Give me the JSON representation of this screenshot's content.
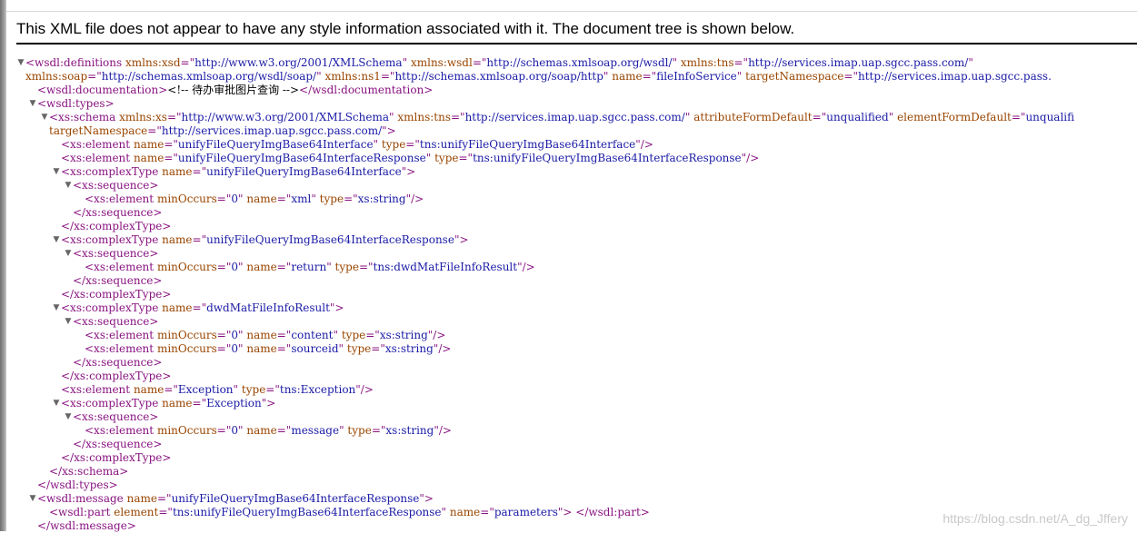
{
  "header": {
    "message": "This XML file does not appear to have any style information associated with it. The document tree is shown below."
  },
  "toggle_glyph": "▼",
  "tree": [
    {
      "segs": [
        [
          "tag",
          "<wsdl:definitions"
        ],
        [
          "txt",
          " "
        ],
        [
          "an",
          "xmlns:xsd"
        ],
        [
          "tag",
          "=\""
        ],
        [
          "av",
          "http://www.w3.org/2001/XMLSchema"
        ],
        [
          "tag",
          "\""
        ],
        [
          "txt",
          " "
        ],
        [
          "an",
          "xmlns:wsdl"
        ],
        [
          "tag",
          "=\""
        ],
        [
          "av",
          "http://schemas.xmlsoap.org/wsdl/"
        ],
        [
          "tag",
          "\""
        ],
        [
          "txt",
          " "
        ],
        [
          "an",
          "xmlns:tns"
        ],
        [
          "tag",
          "=\""
        ],
        [
          "av",
          "http://services.imap.uap.sgcc.pass.com/"
        ],
        [
          "tag",
          "\""
        ]
      ],
      "toggle": true
    },
    {
      "segs": [
        [
          "an",
          "xmlns:soap"
        ],
        [
          "tag",
          "=\""
        ],
        [
          "av",
          "http://schemas.xmlsoap.org/wsdl/soap/"
        ],
        [
          "tag",
          "\""
        ],
        [
          "txt",
          " "
        ],
        [
          "an",
          "xmlns:ns1"
        ],
        [
          "tag",
          "=\""
        ],
        [
          "av",
          "http://schemas.xmlsoap.org/soap/http"
        ],
        [
          "tag",
          "\""
        ],
        [
          "txt",
          " "
        ],
        [
          "an",
          "name"
        ],
        [
          "tag",
          "=\""
        ],
        [
          "av",
          "fileInfoService"
        ],
        [
          "tag",
          "\""
        ],
        [
          "txt",
          " "
        ],
        [
          "an",
          "targetNamespace"
        ],
        [
          "tag",
          "=\""
        ],
        [
          "av",
          "http://services.imap.uap.sgcc.pass."
        ]
      ]
    },
    {
      "segs": [
        [
          "tag",
          "<wsdl:documentation>"
        ],
        [
          "txt",
          "<!-- 待办审批图片查询 -->"
        ],
        [
          "tag",
          "</wsdl:documentation>"
        ]
      ]
    },
    {
      "segs": [
        [
          "tag",
          "<wsdl:types>"
        ]
      ],
      "toggle": true
    },
    {
      "segs": [
        [
          "tag",
          "<xs:schema"
        ],
        [
          "txt",
          " "
        ],
        [
          "an",
          "xmlns:xs"
        ],
        [
          "tag",
          "=\""
        ],
        [
          "av",
          "http://www.w3.org/2001/XMLSchema"
        ],
        [
          "tag",
          "\""
        ],
        [
          "txt",
          " "
        ],
        [
          "an",
          "xmlns:tns"
        ],
        [
          "tag",
          "=\""
        ],
        [
          "av",
          "http://services.imap.uap.sgcc.pass.com/"
        ],
        [
          "tag",
          "\""
        ],
        [
          "txt",
          " "
        ],
        [
          "an",
          "attributeFormDefault"
        ],
        [
          "tag",
          "=\""
        ],
        [
          "av",
          "unqualified"
        ],
        [
          "tag",
          "\""
        ],
        [
          "txt",
          " "
        ],
        [
          "an",
          "elementFormDefault"
        ],
        [
          "tag",
          "=\""
        ],
        [
          "av",
          "unqualifi"
        ]
      ],
      "toggle": true
    },
    {
      "segs": [
        [
          "an",
          "targetNamespace"
        ],
        [
          "tag",
          "=\""
        ],
        [
          "av",
          "http://services.imap.uap.sgcc.pass.com/"
        ],
        [
          "tag",
          "\">"
        ]
      ]
    },
    {
      "segs": [
        [
          "tag",
          "<xs:element"
        ],
        [
          "txt",
          " "
        ],
        [
          "an",
          "name"
        ],
        [
          "tag",
          "=\""
        ],
        [
          "av",
          "unifyFileQueryImgBase64Interface"
        ],
        [
          "tag",
          "\""
        ],
        [
          "txt",
          " "
        ],
        [
          "an",
          "type"
        ],
        [
          "tag",
          "=\""
        ],
        [
          "av",
          "tns:unifyFileQueryImgBase64Interface"
        ],
        [
          "tag",
          "\"/>"
        ]
      ]
    },
    {
      "segs": [
        [
          "tag",
          "<xs:element"
        ],
        [
          "txt",
          " "
        ],
        [
          "an",
          "name"
        ],
        [
          "tag",
          "=\""
        ],
        [
          "av",
          "unifyFileQueryImgBase64InterfaceResponse"
        ],
        [
          "tag",
          "\""
        ],
        [
          "txt",
          " "
        ],
        [
          "an",
          "type"
        ],
        [
          "tag",
          "=\""
        ],
        [
          "av",
          "tns:unifyFileQueryImgBase64InterfaceResponse"
        ],
        [
          "tag",
          "\"/>"
        ]
      ]
    },
    {
      "segs": [
        [
          "tag",
          "<xs:complexType"
        ],
        [
          "txt",
          " "
        ],
        [
          "an",
          "name"
        ],
        [
          "tag",
          "=\""
        ],
        [
          "av",
          "unifyFileQueryImgBase64Interface"
        ],
        [
          "tag",
          "\">"
        ]
      ],
      "toggle": true
    },
    {
      "segs": [
        [
          "tag",
          "<xs:sequence>"
        ]
      ],
      "toggle": true
    },
    {
      "segs": [
        [
          "tag",
          "<xs:element"
        ],
        [
          "txt",
          " "
        ],
        [
          "an",
          "minOccurs"
        ],
        [
          "tag",
          "=\""
        ],
        [
          "av",
          "0"
        ],
        [
          "tag",
          "\""
        ],
        [
          "txt",
          " "
        ],
        [
          "an",
          "name"
        ],
        [
          "tag",
          "=\""
        ],
        [
          "av",
          "xml"
        ],
        [
          "tag",
          "\""
        ],
        [
          "txt",
          " "
        ],
        [
          "an",
          "type"
        ],
        [
          "tag",
          "=\""
        ],
        [
          "av",
          "xs:string"
        ],
        [
          "tag",
          "\"/>"
        ]
      ]
    },
    {
      "segs": [
        [
          "tag",
          "</xs:sequence>"
        ]
      ]
    },
    {
      "segs": [
        [
          "tag",
          "</xs:complexType>"
        ]
      ]
    },
    {
      "segs": [
        [
          "tag",
          "<xs:complexType"
        ],
        [
          "txt",
          " "
        ],
        [
          "an",
          "name"
        ],
        [
          "tag",
          "=\""
        ],
        [
          "av",
          "unifyFileQueryImgBase64InterfaceResponse"
        ],
        [
          "tag",
          "\">"
        ]
      ],
      "toggle": true
    },
    {
      "segs": [
        [
          "tag",
          "<xs:sequence>"
        ]
      ],
      "toggle": true
    },
    {
      "segs": [
        [
          "tag",
          "<xs:element"
        ],
        [
          "txt",
          " "
        ],
        [
          "an",
          "minOccurs"
        ],
        [
          "tag",
          "=\""
        ],
        [
          "av",
          "0"
        ],
        [
          "tag",
          "\""
        ],
        [
          "txt",
          " "
        ],
        [
          "an",
          "name"
        ],
        [
          "tag",
          "=\""
        ],
        [
          "av",
          "return"
        ],
        [
          "tag",
          "\""
        ],
        [
          "txt",
          " "
        ],
        [
          "an",
          "type"
        ],
        [
          "tag",
          "=\""
        ],
        [
          "av",
          "tns:dwdMatFileInfoResult"
        ],
        [
          "tag",
          "\"/>"
        ]
      ]
    },
    {
      "segs": [
        [
          "tag",
          "</xs:sequence>"
        ]
      ]
    },
    {
      "segs": [
        [
          "tag",
          "</xs:complexType>"
        ]
      ]
    },
    {
      "segs": [
        [
          "tag",
          "<xs:complexType"
        ],
        [
          "txt",
          " "
        ],
        [
          "an",
          "name"
        ],
        [
          "tag",
          "=\""
        ],
        [
          "av",
          "dwdMatFileInfoResult"
        ],
        [
          "tag",
          "\">"
        ]
      ],
      "toggle": true
    },
    {
      "segs": [
        [
          "tag",
          "<xs:sequence>"
        ]
      ],
      "toggle": true
    },
    {
      "segs": [
        [
          "tag",
          "<xs:element"
        ],
        [
          "txt",
          " "
        ],
        [
          "an",
          "minOccurs"
        ],
        [
          "tag",
          "=\""
        ],
        [
          "av",
          "0"
        ],
        [
          "tag",
          "\""
        ],
        [
          "txt",
          " "
        ],
        [
          "an",
          "name"
        ],
        [
          "tag",
          "=\""
        ],
        [
          "av",
          "content"
        ],
        [
          "tag",
          "\""
        ],
        [
          "txt",
          " "
        ],
        [
          "an",
          "type"
        ],
        [
          "tag",
          "=\""
        ],
        [
          "av",
          "xs:string"
        ],
        [
          "tag",
          "\"/>"
        ]
      ]
    },
    {
      "segs": [
        [
          "tag",
          "<xs:element"
        ],
        [
          "txt",
          " "
        ],
        [
          "an",
          "minOccurs"
        ],
        [
          "tag",
          "=\""
        ],
        [
          "av",
          "0"
        ],
        [
          "tag",
          "\""
        ],
        [
          "txt",
          " "
        ],
        [
          "an",
          "name"
        ],
        [
          "tag",
          "=\""
        ],
        [
          "av",
          "sourceid"
        ],
        [
          "tag",
          "\""
        ],
        [
          "txt",
          " "
        ],
        [
          "an",
          "type"
        ],
        [
          "tag",
          "=\""
        ],
        [
          "av",
          "xs:string"
        ],
        [
          "tag",
          "\"/>"
        ]
      ]
    },
    {
      "segs": [
        [
          "tag",
          "</xs:sequence>"
        ]
      ]
    },
    {
      "segs": [
        [
          "tag",
          "</xs:complexType>"
        ]
      ]
    },
    {
      "segs": [
        [
          "tag",
          "<xs:element"
        ],
        [
          "txt",
          " "
        ],
        [
          "an",
          "name"
        ],
        [
          "tag",
          "=\""
        ],
        [
          "av",
          "Exception"
        ],
        [
          "tag",
          "\""
        ],
        [
          "txt",
          " "
        ],
        [
          "an",
          "type"
        ],
        [
          "tag",
          "=\""
        ],
        [
          "av",
          "tns:Exception"
        ],
        [
          "tag",
          "\"/>"
        ]
      ]
    },
    {
      "segs": [
        [
          "tag",
          "<xs:complexType"
        ],
        [
          "txt",
          " "
        ],
        [
          "an",
          "name"
        ],
        [
          "tag",
          "=\""
        ],
        [
          "av",
          "Exception"
        ],
        [
          "tag",
          "\">"
        ]
      ],
      "toggle": true
    },
    {
      "segs": [
        [
          "tag",
          "<xs:sequence>"
        ]
      ],
      "toggle": true
    },
    {
      "segs": [
        [
          "tag",
          "<xs:element"
        ],
        [
          "txt",
          " "
        ],
        [
          "an",
          "minOccurs"
        ],
        [
          "tag",
          "=\""
        ],
        [
          "av",
          "0"
        ],
        [
          "tag",
          "\""
        ],
        [
          "txt",
          " "
        ],
        [
          "an",
          "name"
        ],
        [
          "tag",
          "=\""
        ],
        [
          "av",
          "message"
        ],
        [
          "tag",
          "\""
        ],
        [
          "txt",
          " "
        ],
        [
          "an",
          "type"
        ],
        [
          "tag",
          "=\""
        ],
        [
          "av",
          "xs:string"
        ],
        [
          "tag",
          "\"/>"
        ]
      ]
    },
    {
      "segs": [
        [
          "tag",
          "</xs:sequence>"
        ]
      ]
    },
    {
      "segs": [
        [
          "tag",
          "</xs:complexType>"
        ]
      ]
    },
    {
      "segs": [
        [
          "tag",
          "</xs:schema>"
        ]
      ]
    },
    {
      "segs": [
        [
          "tag",
          "</wsdl:types>"
        ]
      ]
    },
    {
      "segs": [
        [
          "tag",
          "<wsdl:message"
        ],
        [
          "txt",
          " "
        ],
        [
          "an",
          "name"
        ],
        [
          "tag",
          "=\""
        ],
        [
          "av",
          "unifyFileQueryImgBase64InterfaceResponse"
        ],
        [
          "tag",
          "\">"
        ]
      ],
      "toggle": true
    },
    {
      "segs": [
        [
          "tag",
          "<wsdl:part"
        ],
        [
          "txt",
          " "
        ],
        [
          "an",
          "element"
        ],
        [
          "tag",
          "=\""
        ],
        [
          "av",
          "tns:unifyFileQueryImgBase64InterfaceResponse"
        ],
        [
          "tag",
          "\""
        ],
        [
          "txt",
          " "
        ],
        [
          "an",
          "name"
        ],
        [
          "tag",
          "=\""
        ],
        [
          "av",
          "parameters"
        ],
        [
          "tag",
          "\">"
        ],
        [
          "txt",
          " "
        ],
        [
          "tag",
          "</wsdl:part>"
        ]
      ]
    },
    {
      "segs": [
        [
          "tag",
          "</wsdl:message>"
        ]
      ]
    }
  ],
  "watermark": "https://blog.csdn.net/A_dg_Jffery"
}
